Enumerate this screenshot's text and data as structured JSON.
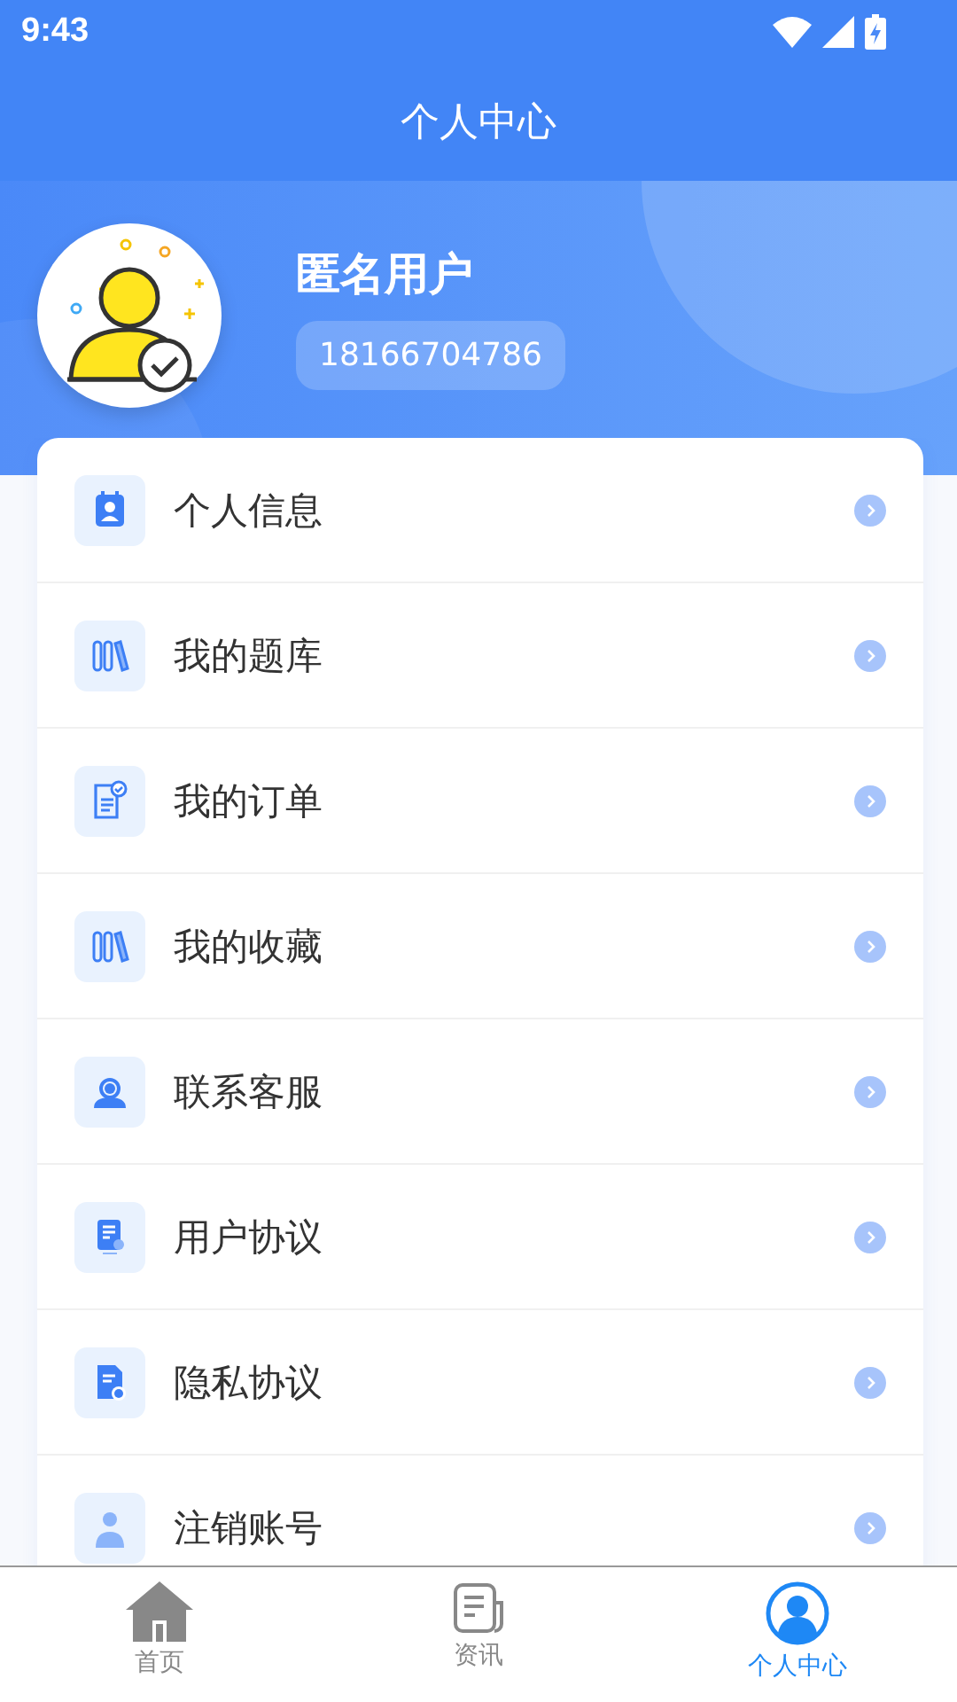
{
  "status_bar": {
    "time": "9:43"
  },
  "title": "个人中心",
  "profile": {
    "name": "匿名用户",
    "phone": "18166704786"
  },
  "menu": [
    {
      "label": "个人信息",
      "kind": "contact"
    },
    {
      "label": "我的题库",
      "kind": "books"
    },
    {
      "label": "我的订单",
      "kind": "order"
    },
    {
      "label": "我的收藏",
      "kind": "books"
    },
    {
      "label": "联系客服",
      "kind": "service"
    },
    {
      "label": "用户协议",
      "kind": "agreement"
    },
    {
      "label": "隐私协议",
      "kind": "privacy"
    },
    {
      "label": "注销账号",
      "kind": "account"
    }
  ],
  "tabs": [
    {
      "label": "首页",
      "kind": "home",
      "selected": false
    },
    {
      "label": "资讯",
      "kind": "news",
      "selected": false
    },
    {
      "label": "个人中心",
      "kind": "profile",
      "selected": true
    }
  ]
}
